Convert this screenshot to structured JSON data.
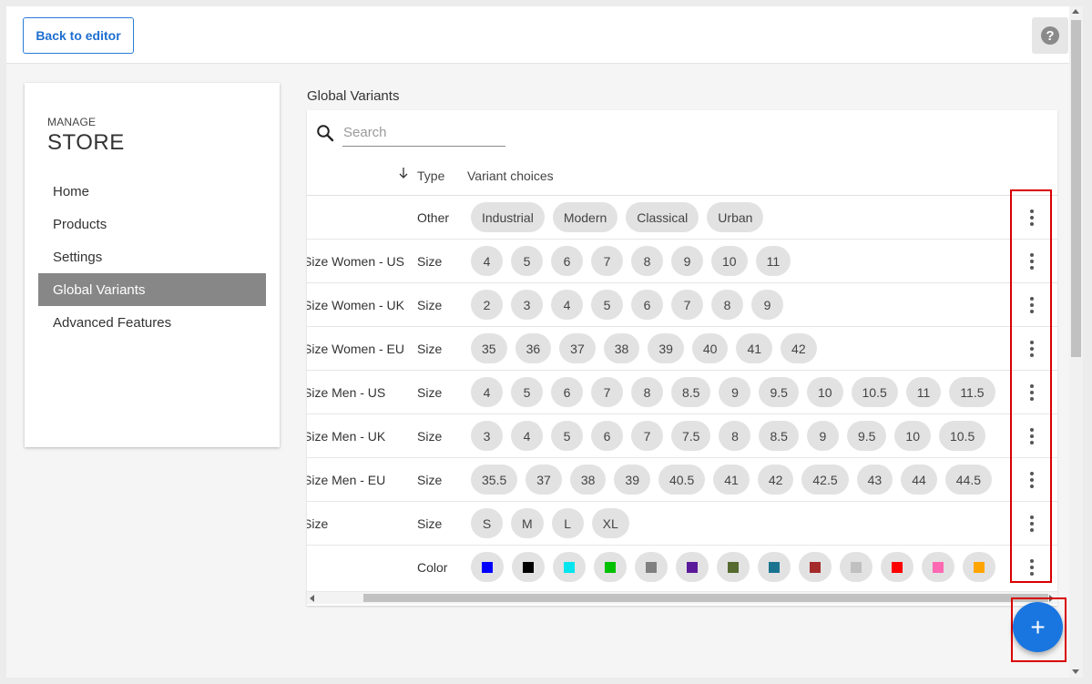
{
  "header": {
    "back_label": "Back to editor",
    "help_glyph": "?"
  },
  "sidebar": {
    "manage": "MANAGE",
    "store": "STORE",
    "items": [
      {
        "label": "Home",
        "active": false
      },
      {
        "label": "Products",
        "active": false
      },
      {
        "label": "Settings",
        "active": false
      },
      {
        "label": "Global Variants",
        "active": true
      },
      {
        "label": "Advanced Features",
        "active": false
      }
    ]
  },
  "main": {
    "title": "Global Variants",
    "search_placeholder": "Search",
    "columns": {
      "type": "Type",
      "choices": "Variant choices"
    },
    "rows": [
      {
        "name": "",
        "type": "Other",
        "choices": [
          "Industrial",
          "Modern",
          "Classical",
          "Urban"
        ]
      },
      {
        "name": "Size Women - US",
        "type": "Size",
        "choices": [
          "4",
          "5",
          "6",
          "7",
          "8",
          "9",
          "10",
          "11"
        ]
      },
      {
        "name": "Size Women - UK",
        "type": "Size",
        "choices": [
          "2",
          "3",
          "4",
          "5",
          "6",
          "7",
          "8",
          "9"
        ]
      },
      {
        "name": "Size Women - EU",
        "type": "Size",
        "choices": [
          "35",
          "36",
          "37",
          "38",
          "39",
          "40",
          "41",
          "42"
        ]
      },
      {
        "name": "Size Men - US",
        "type": "Size",
        "choices": [
          "4",
          "5",
          "6",
          "7",
          "8",
          "8.5",
          "9",
          "9.5",
          "10",
          "10.5",
          "11",
          "11.5"
        ]
      },
      {
        "name": "Size Men - UK",
        "type": "Size",
        "choices": [
          "3",
          "4",
          "5",
          "6",
          "7",
          "7.5",
          "8",
          "8.5",
          "9",
          "9.5",
          "10",
          "10.5"
        ]
      },
      {
        "name": "Size Men - EU",
        "type": "Size",
        "choices": [
          "35.5",
          "37",
          "38",
          "39",
          "40.5",
          "41",
          "42",
          "42.5",
          "43",
          "44",
          "44.5"
        ]
      },
      {
        "name": "Size",
        "type": "Size",
        "choices": [
          "S",
          "M",
          "L",
          "XL"
        ]
      },
      {
        "name": "",
        "type": "Color",
        "choices": [],
        "colors": [
          "#0000ff",
          "#000000",
          "#00e5ee",
          "#00c000",
          "#808080",
          "#5a1a9a",
          "#556b2f",
          "#1a7490",
          "#a52a2a",
          "#c0c0c0",
          "#ff0000",
          "#ff69b4",
          "#ffa500"
        ]
      }
    ]
  },
  "colors": {
    "accent": "#1976e0",
    "active_nav": "#878787",
    "highlight": "#d90000"
  },
  "fab": {
    "glyph": "+"
  }
}
